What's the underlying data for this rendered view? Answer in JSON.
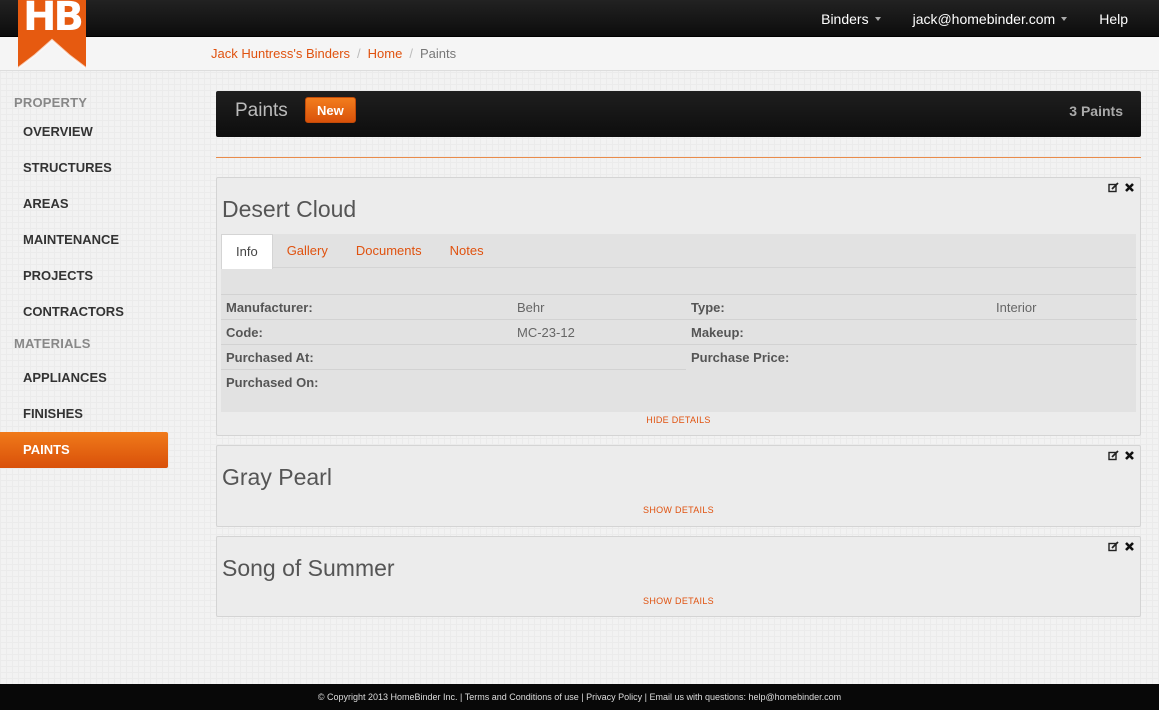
{
  "app": {
    "logo_text": "HB",
    "brand_color": "#e65a10"
  },
  "topnav": {
    "binders_label": "Binders",
    "account_label": "jack@homebinder.com",
    "help_label": "Help"
  },
  "breadcrumb": {
    "items": [
      "Jack Huntress's Binders",
      "Home"
    ],
    "current": "Paints"
  },
  "sidebar": {
    "property_heading": "PROPERTY",
    "property_items": [
      "OVERVIEW",
      "STRUCTURES",
      "AREAS",
      "MAINTENANCE",
      "PROJECTS",
      "CONTRACTORS"
    ],
    "materials_heading": "MATERIALS",
    "materials_items": [
      "APPLIANCES",
      "FINISHES",
      "PAINTS"
    ],
    "active_item": "PAINTS"
  },
  "page": {
    "title": "Paints",
    "new_label": "New",
    "count_label": "3 Paints"
  },
  "paints": [
    {
      "name": "Desert Cloud",
      "expanded": true,
      "toggle_label": "HIDE DETAILS",
      "tabs": [
        "Info",
        "Gallery",
        "Documents",
        "Notes"
      ],
      "active_tab": "Info",
      "details": {
        "manufacturer_label": "Manufacturer:",
        "manufacturer_value": "Behr",
        "type_label": "Type:",
        "type_value": "Interior",
        "code_label": "Code:",
        "code_value": "MC-23-12",
        "makeup_label": "Makeup:",
        "makeup_value": "",
        "purchased_at_label": "Purchased At:",
        "purchased_at_value": "",
        "purchase_price_label": "Purchase Price:",
        "purchase_price_value": "",
        "purchased_on_label": "Purchased On:",
        "purchased_on_value": ""
      }
    },
    {
      "name": "Gray Pearl",
      "expanded": false,
      "toggle_label": "SHOW DETAILS"
    },
    {
      "name": "Song of Summer",
      "expanded": false,
      "toggle_label": "SHOW DETAILS"
    }
  ],
  "icons": {
    "edit": "edit-icon",
    "delete": "delete-icon"
  },
  "footer": {
    "text": "© Copyright 2013 HomeBinder Inc. | Terms and Conditions of use | Privacy Policy | Email us with questions: help@homebinder.com"
  }
}
